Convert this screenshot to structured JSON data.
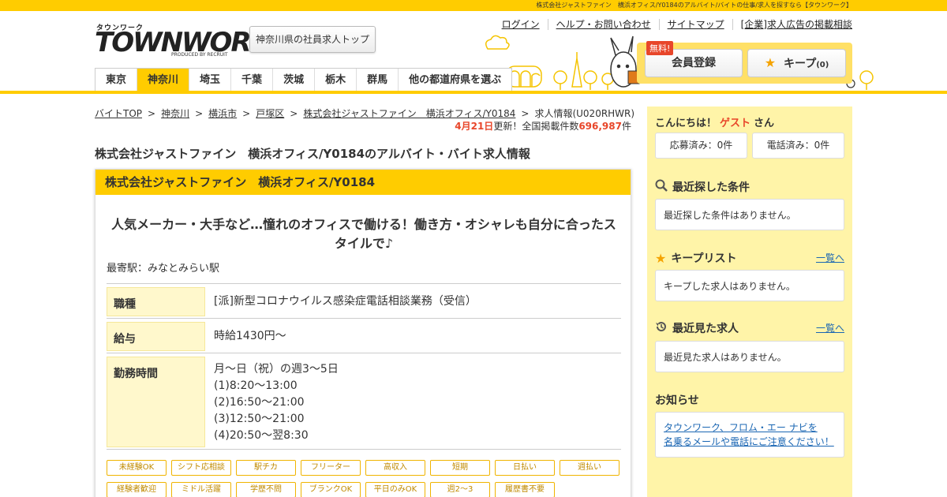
{
  "top_strip": "株式会社ジャストファイン　横浜オフィス/Y0184のアルバイト/バイトの仕事/求人を探すなら【タウンワーク】",
  "logo": {
    "katakana": "タウンワーク",
    "word": "TOWNWORK",
    "produced": "PRODUCED BY RECRUIT"
  },
  "header": {
    "pref_top_button": "神奈川県の社員求人トップ",
    "util_links": [
      "ログイン",
      "ヘルプ・お問い合わせ",
      "サイトマップ",
      "[企業]求人広告の掲載相談"
    ],
    "free_badge": "無料!",
    "register_button": "会員登録",
    "keep_button": "キープ",
    "keep_count": "(0)"
  },
  "nav": {
    "tabs": [
      "東京",
      "神奈川",
      "埼玉",
      "千葉",
      "茨城",
      "栃木",
      "群馬",
      "他の都道府県を選ぶ"
    ],
    "active": "神奈川"
  },
  "breadcrumb": {
    "items": [
      "バイトTOP",
      "神奈川",
      "横浜市",
      "戸塚区",
      "株式会社ジャストファイン　横浜オフィス/Y0184"
    ],
    "current": "求人情報(U020RHWR)"
  },
  "updated": {
    "date": "4月21日",
    "text1": "更新！全国掲載件数",
    "count": "696,987",
    "unit": "件"
  },
  "page_title": "株式会社ジャストファイン　横浜オフィス/Y0184のアルバイト・バイト求人情報",
  "job": {
    "company": "株式会社ジャストファイン　横浜オフィス/Y0184",
    "catch_line1": "人気メーカー・大手など…憧れのオフィスで働ける！働き方・オシャレも自分に合ったス",
    "catch_line2": "タイルで♪",
    "station": "最寄駅：みなとみらい駅",
    "rows": {
      "occupation": {
        "label": "職種",
        "value": "[派]新型コロナウイルス感染症電話相談業務（受信）"
      },
      "salary": {
        "label": "給与",
        "value": "時給1430円～"
      },
      "hours": {
        "label": "勤務時間",
        "lines": [
          "月～日（祝）の週3～5日",
          "(1)8:20～13:00",
          "(2)16:50～21:00",
          "(3)12:50～21:00",
          "(4)20:50～翌8:30"
        ]
      }
    },
    "tags": [
      "未経験OK",
      "シフト応相談",
      "駅チカ",
      "フリーター",
      "高収入",
      "短期",
      "日払い",
      "週払い",
      "経験者歓迎",
      "ミドル活躍",
      "学歴不問",
      "ブランクOK",
      "平日のみOK",
      "週2～3",
      "履歴書不要"
    ]
  },
  "sidebar": {
    "greeting": "こんにちは！",
    "guest": "ゲスト",
    "san": "さん",
    "applied": "応募済み：0件",
    "called": "電話済み：0件",
    "recent_search_title": "最近探した条件",
    "recent_search_empty": "最近探した条件はありません。",
    "keep_title": "キープリスト",
    "keep_link": "一覧へ",
    "keep_empty": "キープした求人はありません。",
    "viewed_title": "最近見た求人",
    "viewed_link": "一覧へ",
    "viewed_empty": "最近見た求人はありません。",
    "notice_title": "お知らせ",
    "notice_line1": "タウンワーク、フロム・エー ナビを",
    "notice_line2": "名乗るメールや電話にご注意ください！"
  },
  "colors": {
    "brand_yellow": "#ffcc00",
    "accent_red": "#e8462a",
    "link_blue": "#1a66b3",
    "sidebar_bg": "#fff4a8"
  }
}
